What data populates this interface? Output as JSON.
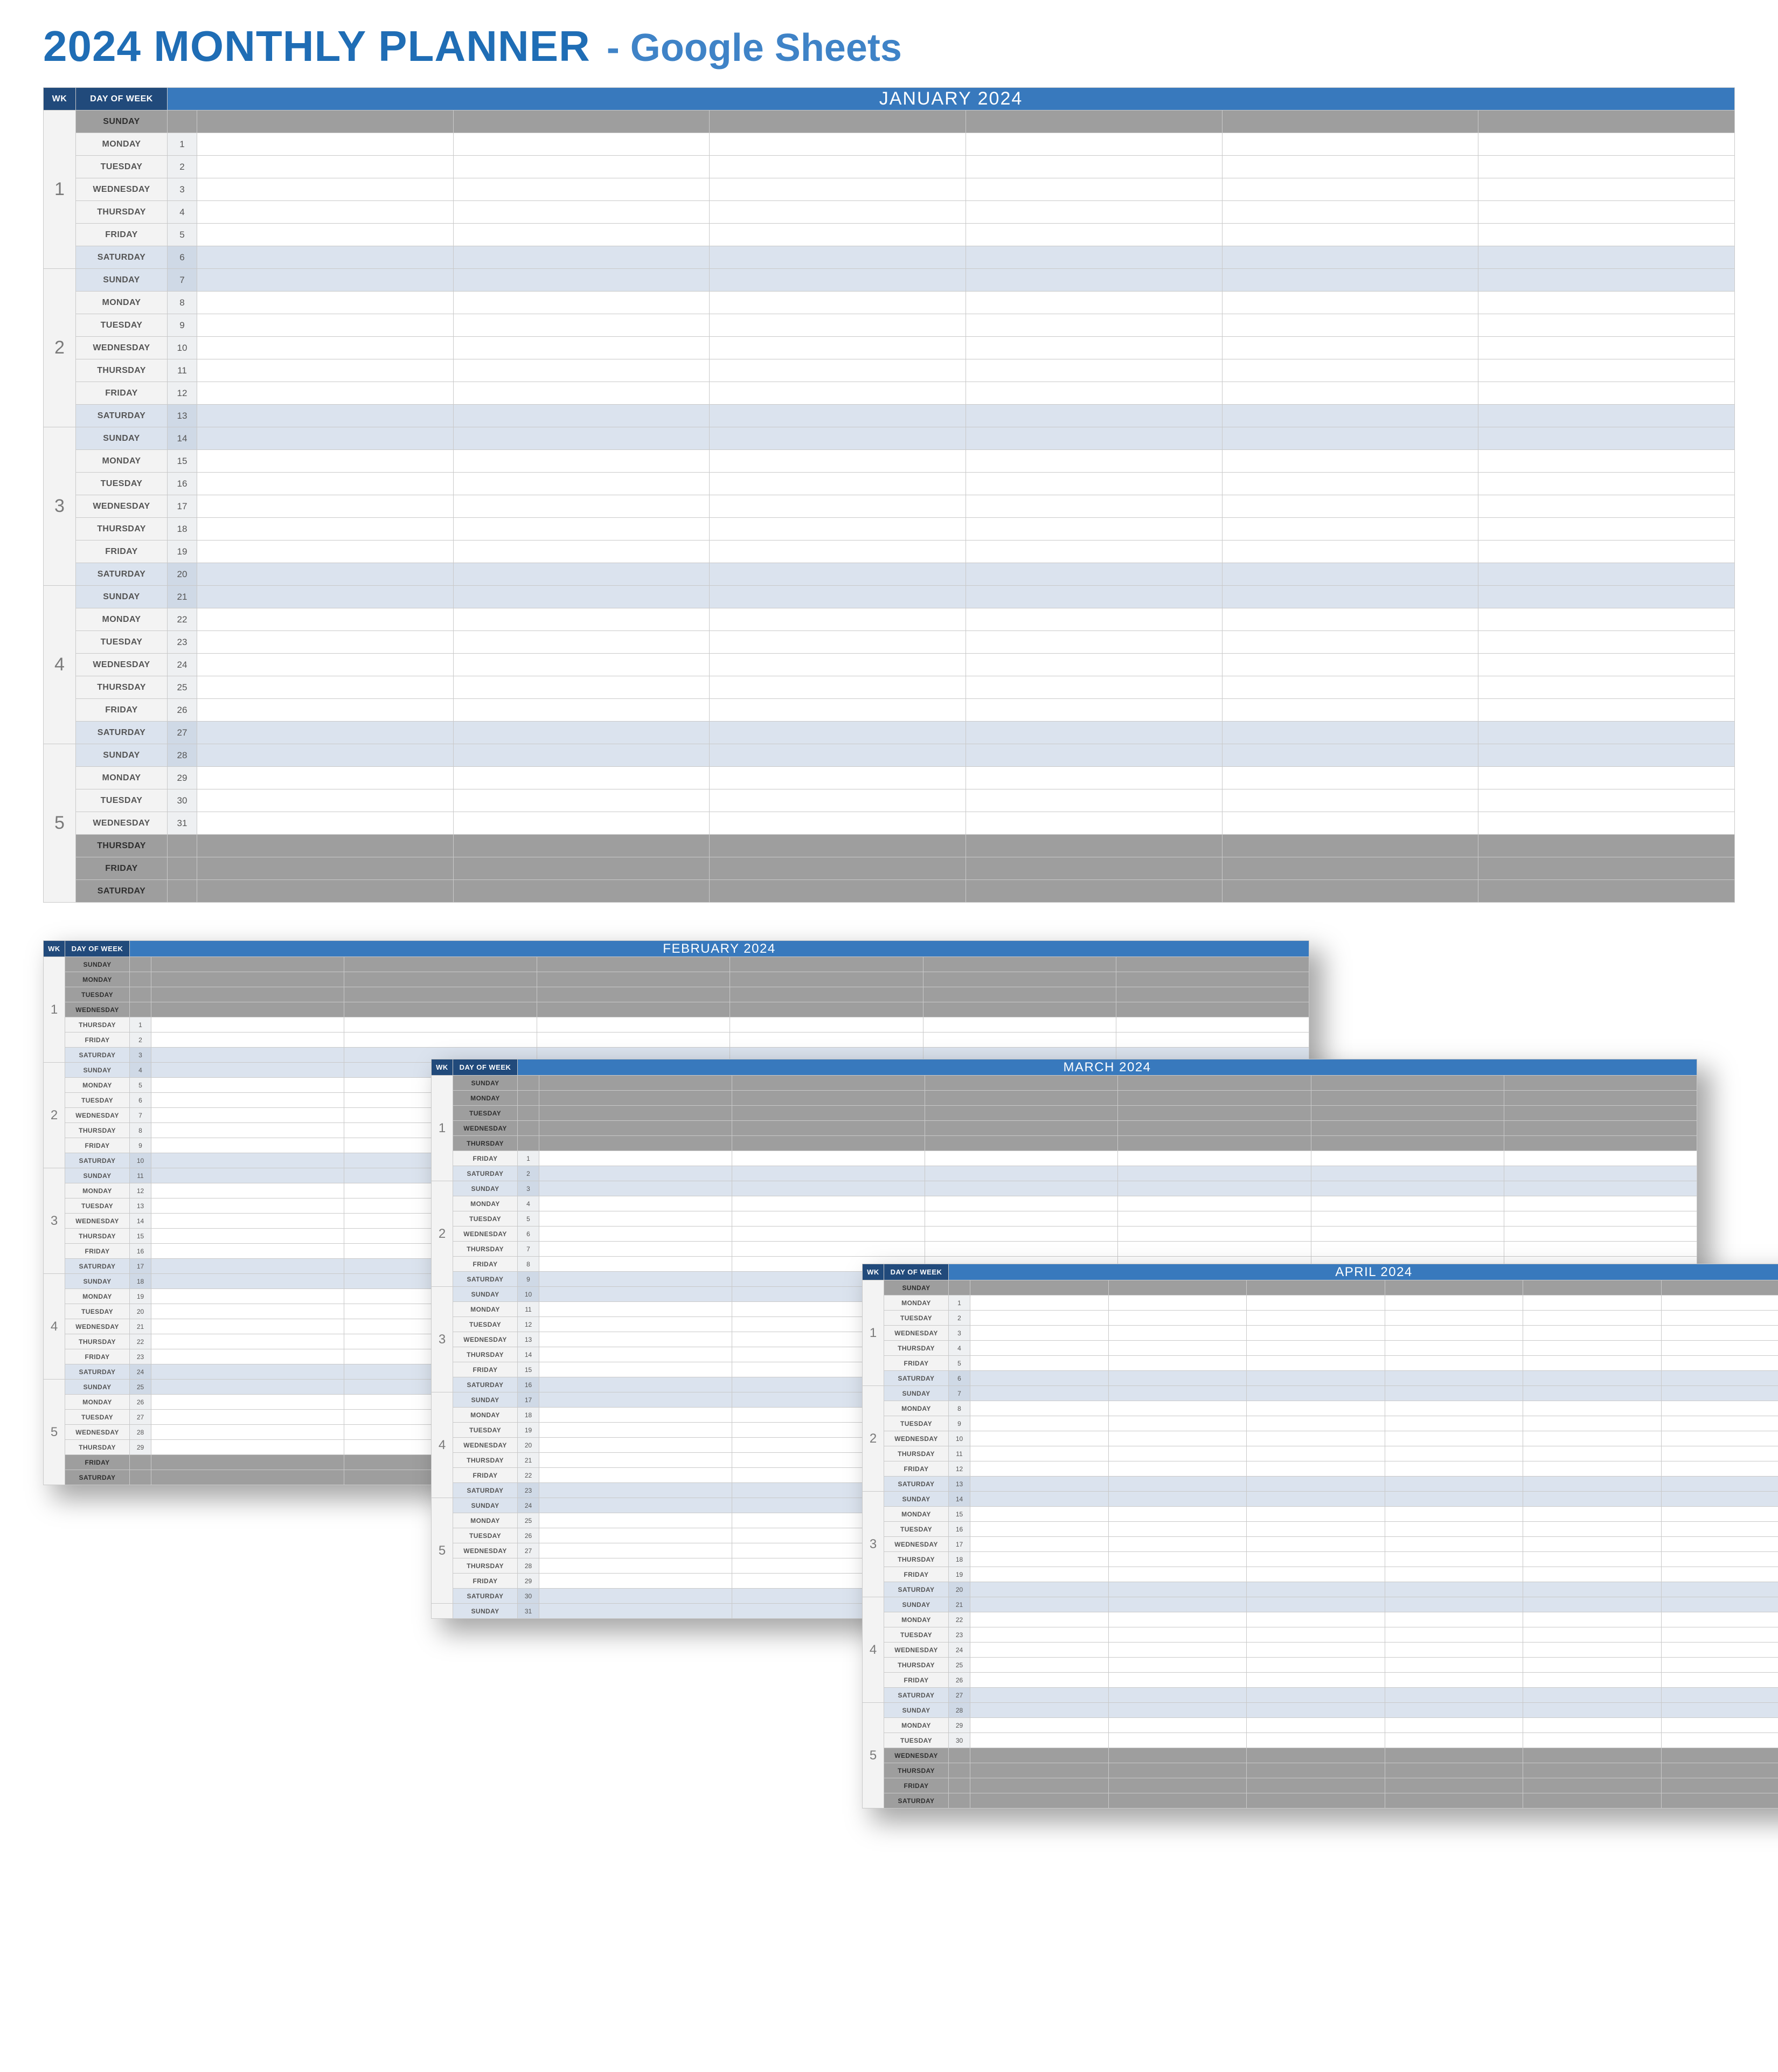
{
  "title_main": "2024 MONTHLY PLANNER",
  "title_sub": "- Google Sheets",
  "hdr_wk": "WK",
  "hdr_dow": "DAY OF WEEK",
  "slots": 6,
  "months": [
    {
      "name": "JANUARY 2024",
      "weeks": [
        {
          "wk": "1",
          "days": [
            {
              "d": "SUNDAY",
              "n": "",
              "m": "out"
            },
            {
              "d": "MONDAY",
              "n": "1",
              "m": ""
            },
            {
              "d": "TUESDAY",
              "n": "2",
              "m": ""
            },
            {
              "d": "WEDNESDAY",
              "n": "3",
              "m": ""
            },
            {
              "d": "THURSDAY",
              "n": "4",
              "m": ""
            },
            {
              "d": "FRIDAY",
              "n": "5",
              "m": ""
            },
            {
              "d": "SATURDAY",
              "n": "6",
              "m": "we"
            }
          ]
        },
        {
          "wk": "2",
          "days": [
            {
              "d": "SUNDAY",
              "n": "7",
              "m": "we"
            },
            {
              "d": "MONDAY",
              "n": "8",
              "m": ""
            },
            {
              "d": "TUESDAY",
              "n": "9",
              "m": ""
            },
            {
              "d": "WEDNESDAY",
              "n": "10",
              "m": ""
            },
            {
              "d": "THURSDAY",
              "n": "11",
              "m": ""
            },
            {
              "d": "FRIDAY",
              "n": "12",
              "m": ""
            },
            {
              "d": "SATURDAY",
              "n": "13",
              "m": "we"
            }
          ]
        },
        {
          "wk": "3",
          "days": [
            {
              "d": "SUNDAY",
              "n": "14",
              "m": "we"
            },
            {
              "d": "MONDAY",
              "n": "15",
              "m": ""
            },
            {
              "d": "TUESDAY",
              "n": "16",
              "m": ""
            },
            {
              "d": "WEDNESDAY",
              "n": "17",
              "m": ""
            },
            {
              "d": "THURSDAY",
              "n": "18",
              "m": ""
            },
            {
              "d": "FRIDAY",
              "n": "19",
              "m": ""
            },
            {
              "d": "SATURDAY",
              "n": "20",
              "m": "we"
            }
          ]
        },
        {
          "wk": "4",
          "days": [
            {
              "d": "SUNDAY",
              "n": "21",
              "m": "we"
            },
            {
              "d": "MONDAY",
              "n": "22",
              "m": ""
            },
            {
              "d": "TUESDAY",
              "n": "23",
              "m": ""
            },
            {
              "d": "WEDNESDAY",
              "n": "24",
              "m": ""
            },
            {
              "d": "THURSDAY",
              "n": "25",
              "m": ""
            },
            {
              "d": "FRIDAY",
              "n": "26",
              "m": ""
            },
            {
              "d": "SATURDAY",
              "n": "27",
              "m": "we"
            }
          ]
        },
        {
          "wk": "5",
          "days": [
            {
              "d": "SUNDAY",
              "n": "28",
              "m": "we"
            },
            {
              "d": "MONDAY",
              "n": "29",
              "m": ""
            },
            {
              "d": "TUESDAY",
              "n": "30",
              "m": ""
            },
            {
              "d": "WEDNESDAY",
              "n": "31",
              "m": ""
            },
            {
              "d": "THURSDAY",
              "n": "",
              "m": "out"
            },
            {
              "d": "FRIDAY",
              "n": "",
              "m": "out"
            },
            {
              "d": "SATURDAY",
              "n": "",
              "m": "out"
            }
          ]
        }
      ]
    },
    {
      "name": "FEBRUARY 2024",
      "weeks": [
        {
          "wk": "1",
          "days": [
            {
              "d": "SUNDAY",
              "n": "",
              "m": "out"
            },
            {
              "d": "MONDAY",
              "n": "",
              "m": "out"
            },
            {
              "d": "TUESDAY",
              "n": "",
              "m": "out"
            },
            {
              "d": "WEDNESDAY",
              "n": "",
              "m": "out"
            },
            {
              "d": "THURSDAY",
              "n": "1",
              "m": ""
            },
            {
              "d": "FRIDAY",
              "n": "2",
              "m": ""
            },
            {
              "d": "SATURDAY",
              "n": "3",
              "m": "we"
            }
          ]
        },
        {
          "wk": "2",
          "days": [
            {
              "d": "SUNDAY",
              "n": "4",
              "m": "we"
            },
            {
              "d": "MONDAY",
              "n": "5",
              "m": ""
            },
            {
              "d": "TUESDAY",
              "n": "6",
              "m": ""
            },
            {
              "d": "WEDNESDAY",
              "n": "7",
              "m": ""
            },
            {
              "d": "THURSDAY",
              "n": "8",
              "m": ""
            },
            {
              "d": "FRIDAY",
              "n": "9",
              "m": ""
            },
            {
              "d": "SATURDAY",
              "n": "10",
              "m": "we"
            }
          ]
        },
        {
          "wk": "3",
          "days": [
            {
              "d": "SUNDAY",
              "n": "11",
              "m": "we"
            },
            {
              "d": "MONDAY",
              "n": "12",
              "m": ""
            },
            {
              "d": "TUESDAY",
              "n": "13",
              "m": ""
            },
            {
              "d": "WEDNESDAY",
              "n": "14",
              "m": ""
            },
            {
              "d": "THURSDAY",
              "n": "15",
              "m": ""
            },
            {
              "d": "FRIDAY",
              "n": "16",
              "m": ""
            },
            {
              "d": "SATURDAY",
              "n": "17",
              "m": "we"
            }
          ]
        },
        {
          "wk": "4",
          "days": [
            {
              "d": "SUNDAY",
              "n": "18",
              "m": "we"
            },
            {
              "d": "MONDAY",
              "n": "19",
              "m": ""
            },
            {
              "d": "TUESDAY",
              "n": "20",
              "m": ""
            },
            {
              "d": "WEDNESDAY",
              "n": "21",
              "m": ""
            },
            {
              "d": "THURSDAY",
              "n": "22",
              "m": ""
            },
            {
              "d": "FRIDAY",
              "n": "23",
              "m": ""
            },
            {
              "d": "SATURDAY",
              "n": "24",
              "m": "we"
            }
          ]
        },
        {
          "wk": "5",
          "days": [
            {
              "d": "SUNDAY",
              "n": "25",
              "m": "we"
            },
            {
              "d": "MONDAY",
              "n": "26",
              "m": ""
            },
            {
              "d": "TUESDAY",
              "n": "27",
              "m": ""
            },
            {
              "d": "WEDNESDAY",
              "n": "28",
              "m": ""
            },
            {
              "d": "THURSDAY",
              "n": "29",
              "m": ""
            },
            {
              "d": "FRIDAY",
              "n": "",
              "m": "out"
            },
            {
              "d": "SATURDAY",
              "n": "",
              "m": "out"
            }
          ]
        }
      ]
    },
    {
      "name": "MARCH 2024",
      "weeks": [
        {
          "wk": "1",
          "days": [
            {
              "d": "SUNDAY",
              "n": "",
              "m": "out"
            },
            {
              "d": "MONDAY",
              "n": "",
              "m": "out"
            },
            {
              "d": "TUESDAY",
              "n": "",
              "m": "out"
            },
            {
              "d": "WEDNESDAY",
              "n": "",
              "m": "out"
            },
            {
              "d": "THURSDAY",
              "n": "",
              "m": "out"
            },
            {
              "d": "FRIDAY",
              "n": "1",
              "m": ""
            },
            {
              "d": "SATURDAY",
              "n": "2",
              "m": "we"
            }
          ]
        },
        {
          "wk": "2",
          "days": [
            {
              "d": "SUNDAY",
              "n": "3",
              "m": "we"
            },
            {
              "d": "MONDAY",
              "n": "4",
              "m": ""
            },
            {
              "d": "TUESDAY",
              "n": "5",
              "m": ""
            },
            {
              "d": "WEDNESDAY",
              "n": "6",
              "m": ""
            },
            {
              "d": "THURSDAY",
              "n": "7",
              "m": ""
            },
            {
              "d": "FRIDAY",
              "n": "8",
              "m": ""
            },
            {
              "d": "SATURDAY",
              "n": "9",
              "m": "we"
            }
          ]
        },
        {
          "wk": "3",
          "days": [
            {
              "d": "SUNDAY",
              "n": "10",
              "m": "we"
            },
            {
              "d": "MONDAY",
              "n": "11",
              "m": ""
            },
            {
              "d": "TUESDAY",
              "n": "12",
              "m": ""
            },
            {
              "d": "WEDNESDAY",
              "n": "13",
              "m": ""
            },
            {
              "d": "THURSDAY",
              "n": "14",
              "m": ""
            },
            {
              "d": "FRIDAY",
              "n": "15",
              "m": ""
            },
            {
              "d": "SATURDAY",
              "n": "16",
              "m": "we"
            }
          ]
        },
        {
          "wk": "4",
          "days": [
            {
              "d": "SUNDAY",
              "n": "17",
              "m": "we"
            },
            {
              "d": "MONDAY",
              "n": "18",
              "m": ""
            },
            {
              "d": "TUESDAY",
              "n": "19",
              "m": ""
            },
            {
              "d": "WEDNESDAY",
              "n": "20",
              "m": ""
            },
            {
              "d": "THURSDAY",
              "n": "21",
              "m": ""
            },
            {
              "d": "FRIDAY",
              "n": "22",
              "m": ""
            },
            {
              "d": "SATURDAY",
              "n": "23",
              "m": "we"
            }
          ]
        },
        {
          "wk": "5",
          "days": [
            {
              "d": "SUNDAY",
              "n": "24",
              "m": "we"
            },
            {
              "d": "MONDAY",
              "n": "25",
              "m": ""
            },
            {
              "d": "TUESDAY",
              "n": "26",
              "m": ""
            },
            {
              "d": "WEDNESDAY",
              "n": "27",
              "m": ""
            },
            {
              "d": "THURSDAY",
              "n": "28",
              "m": ""
            },
            {
              "d": "FRIDAY",
              "n": "29",
              "m": ""
            },
            {
              "d": "SATURDAY",
              "n": "30",
              "m": "we"
            }
          ]
        },
        {
          "wk": "",
          "days": [
            {
              "d": "SUNDAY",
              "n": "31",
              "m": "we"
            }
          ]
        }
      ]
    },
    {
      "name": "APRIL 2024",
      "weeks": [
        {
          "wk": "1",
          "days": [
            {
              "d": "SUNDAY",
              "n": "",
              "m": "out"
            },
            {
              "d": "MONDAY",
              "n": "1",
              "m": ""
            },
            {
              "d": "TUESDAY",
              "n": "2",
              "m": ""
            },
            {
              "d": "WEDNESDAY",
              "n": "3",
              "m": ""
            },
            {
              "d": "THURSDAY",
              "n": "4",
              "m": ""
            },
            {
              "d": "FRIDAY",
              "n": "5",
              "m": ""
            },
            {
              "d": "SATURDAY",
              "n": "6",
              "m": "we"
            }
          ]
        },
        {
          "wk": "2",
          "days": [
            {
              "d": "SUNDAY",
              "n": "7",
              "m": "we"
            },
            {
              "d": "MONDAY",
              "n": "8",
              "m": ""
            },
            {
              "d": "TUESDAY",
              "n": "9",
              "m": ""
            },
            {
              "d": "WEDNESDAY",
              "n": "10",
              "m": ""
            },
            {
              "d": "THURSDAY",
              "n": "11",
              "m": ""
            },
            {
              "d": "FRIDAY",
              "n": "12",
              "m": ""
            },
            {
              "d": "SATURDAY",
              "n": "13",
              "m": "we"
            }
          ]
        },
        {
          "wk": "3",
          "days": [
            {
              "d": "SUNDAY",
              "n": "14",
              "m": "we"
            },
            {
              "d": "MONDAY",
              "n": "15",
              "m": ""
            },
            {
              "d": "TUESDAY",
              "n": "16",
              "m": ""
            },
            {
              "d": "WEDNESDAY",
              "n": "17",
              "m": ""
            },
            {
              "d": "THURSDAY",
              "n": "18",
              "m": ""
            },
            {
              "d": "FRIDAY",
              "n": "19",
              "m": ""
            },
            {
              "d": "SATURDAY",
              "n": "20",
              "m": "we"
            }
          ]
        },
        {
          "wk": "4",
          "days": [
            {
              "d": "SUNDAY",
              "n": "21",
              "m": "we"
            },
            {
              "d": "MONDAY",
              "n": "22",
              "m": ""
            },
            {
              "d": "TUESDAY",
              "n": "23",
              "m": ""
            },
            {
              "d": "WEDNESDAY",
              "n": "24",
              "m": ""
            },
            {
              "d": "THURSDAY",
              "n": "25",
              "m": ""
            },
            {
              "d": "FRIDAY",
              "n": "26",
              "m": ""
            },
            {
              "d": "SATURDAY",
              "n": "27",
              "m": "we"
            }
          ]
        },
        {
          "wk": "5",
          "days": [
            {
              "d": "SUNDAY",
              "n": "28",
              "m": "we"
            },
            {
              "d": "MONDAY",
              "n": "29",
              "m": ""
            },
            {
              "d": "TUESDAY",
              "n": "30",
              "m": ""
            },
            {
              "d": "WEDNESDAY",
              "n": "",
              "m": "out"
            },
            {
              "d": "THURSDAY",
              "n": "",
              "m": "out"
            },
            {
              "d": "FRIDAY",
              "n": "",
              "m": "out"
            },
            {
              "d": "SATURDAY",
              "n": "",
              "m": "out"
            }
          ]
        }
      ]
    }
  ]
}
